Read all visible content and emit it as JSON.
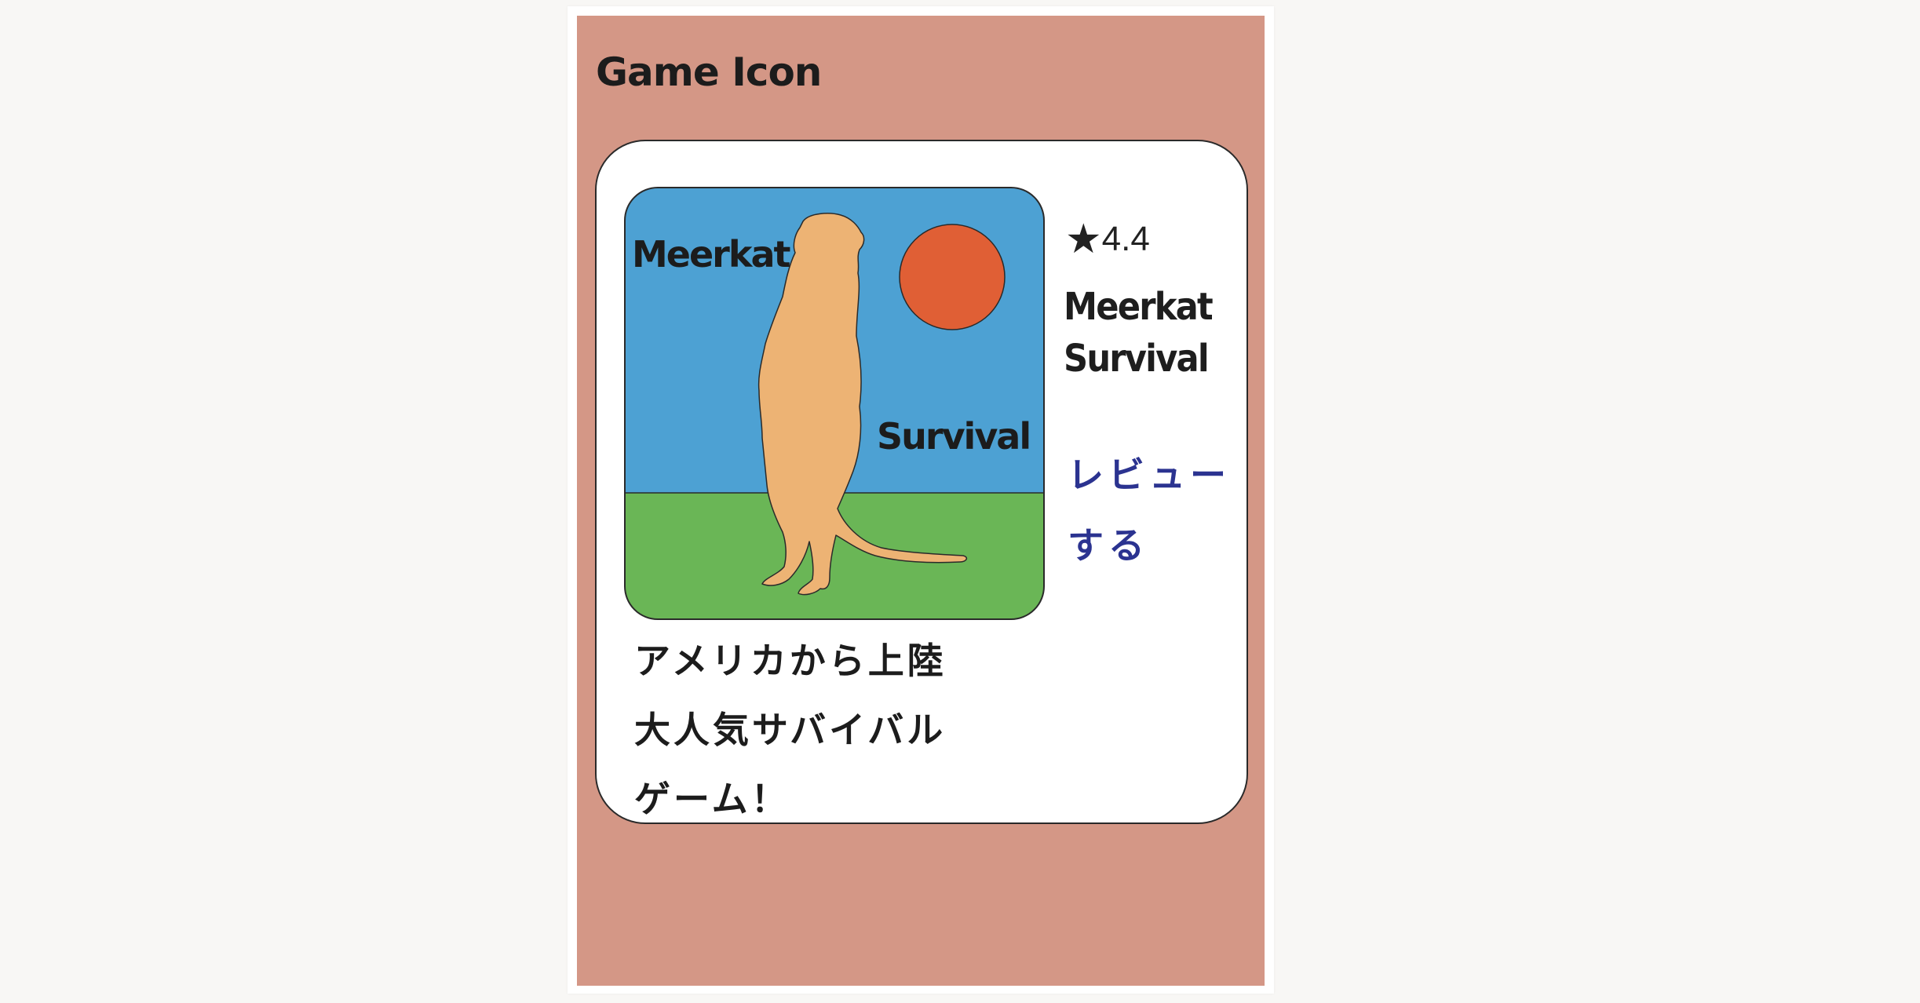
{
  "panel": {
    "title": "Game Icon",
    "background_color": "#d49786"
  },
  "game": {
    "icon": {
      "text_top": "Meerkat",
      "text_bottom": "Survival",
      "sky_color": "#4da1d3",
      "grass_color": "#6ab656",
      "sun_color": "#e05f35",
      "meerkat_color": "#edb374"
    },
    "rating_star": "★",
    "rating_value": "4.4",
    "name_line1": "Meerkat",
    "name_line2": "Survival",
    "review_line1": "レビュー",
    "review_line2": "する",
    "review_color": "#2b3390",
    "tagline_lines": [
      "アメリカから上陸",
      "大人気サバイバル",
      "ゲーム！"
    ]
  }
}
